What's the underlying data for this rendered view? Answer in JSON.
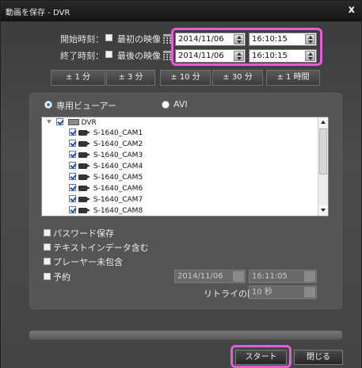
{
  "window": {
    "title": "動画を保存 - DVR",
    "close_glyph": "x"
  },
  "time": {
    "start_label": "開始時刻：",
    "start_option": "最初の映像",
    "start_date": "2014/11/06",
    "start_time": "16:10:15",
    "end_label": "終了時刻：",
    "end_option": "最後の映像",
    "end_date": "2014/11/06",
    "end_time": "16:10:15"
  },
  "step_buttons": [
    "± 1 分",
    "± 3 分",
    "± 10 分",
    "± 30 分",
    "± 1 時間"
  ],
  "format": {
    "option_viewer": "専用ビューアー",
    "option_avi": "AVI",
    "selected": "専用ビューアー"
  },
  "tree": {
    "root": "DVR",
    "cameras": [
      "S-1640_CAM1",
      "S-1640_CAM2",
      "S-1640_CAM3",
      "S-1640_CAM4",
      "S-1640_CAM5",
      "S-1640_CAM6",
      "S-1640_CAM7",
      "S-1640_CAM8"
    ]
  },
  "options": {
    "password_save": "パスワード保存",
    "include_text": "テキストインデータ含む",
    "no_player": "プレーヤー未包含",
    "schedule": "予約",
    "schedule_date": "2014/11/06",
    "schedule_time": "16:11:05",
    "retry_label": "リトライの間隔：",
    "retry_value": "10 秒"
  },
  "buttons": {
    "start": "スタート",
    "close": "閉じる"
  },
  "colors": {
    "highlight": "#e05fd8",
    "radio_on": "#2a73d6"
  }
}
